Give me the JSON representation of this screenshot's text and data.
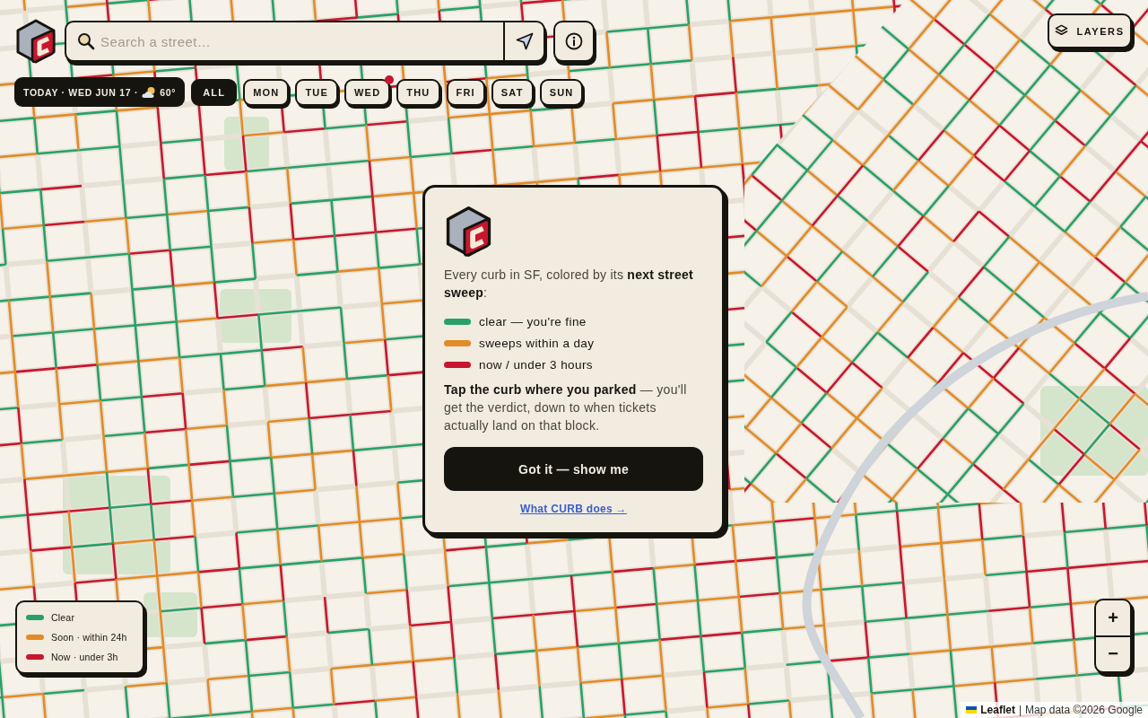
{
  "search": {
    "placeholder": "Search a street…"
  },
  "date_badge": {
    "date": "TODAY · WED JUN 17 ·",
    "temperature": "60°"
  },
  "day_filters": [
    {
      "label": "ALL",
      "selected": true,
      "today": false
    },
    {
      "label": "MON",
      "selected": false,
      "today": false
    },
    {
      "label": "TUE",
      "selected": false,
      "today": false
    },
    {
      "label": "WED",
      "selected": false,
      "today": true
    },
    {
      "label": "THU",
      "selected": false,
      "today": false
    },
    {
      "label": "FRI",
      "selected": false,
      "today": false
    },
    {
      "label": "SAT",
      "selected": false,
      "today": false
    },
    {
      "label": "SUN",
      "selected": false,
      "today": false
    }
  ],
  "layers_button": {
    "label": "LAYERS"
  },
  "intro_card": {
    "text": "Every curb in SF, colored by its **next street sweep**:",
    "legend": [
      {
        "label": "clear — you're fine",
        "color": "#27a169"
      },
      {
        "label": "sweeps within a day",
        "color": "#e38b26"
      },
      {
        "label": "now / under 3 hours",
        "color": "#c8162f"
      }
    ],
    "note": "**Tap the curb where you parked** — you'll get the verdict, down to when tickets actually land on that block.",
    "button": "Got it — show me",
    "link": "What CURB does →"
  },
  "legend": [
    {
      "label": "Clear",
      "color": "#27a169"
    },
    {
      "label": "Soon · within 24h",
      "color": "#e38b26"
    },
    {
      "label": "Now · under 3h",
      "color": "#c8162f"
    }
  ],
  "zoom_control": {
    "zoom_in": "+",
    "zoom_out": "−"
  },
  "attribution": {
    "link": "Leaflet",
    "separator": "|",
    "text": "Map data ©2026 Google"
  }
}
